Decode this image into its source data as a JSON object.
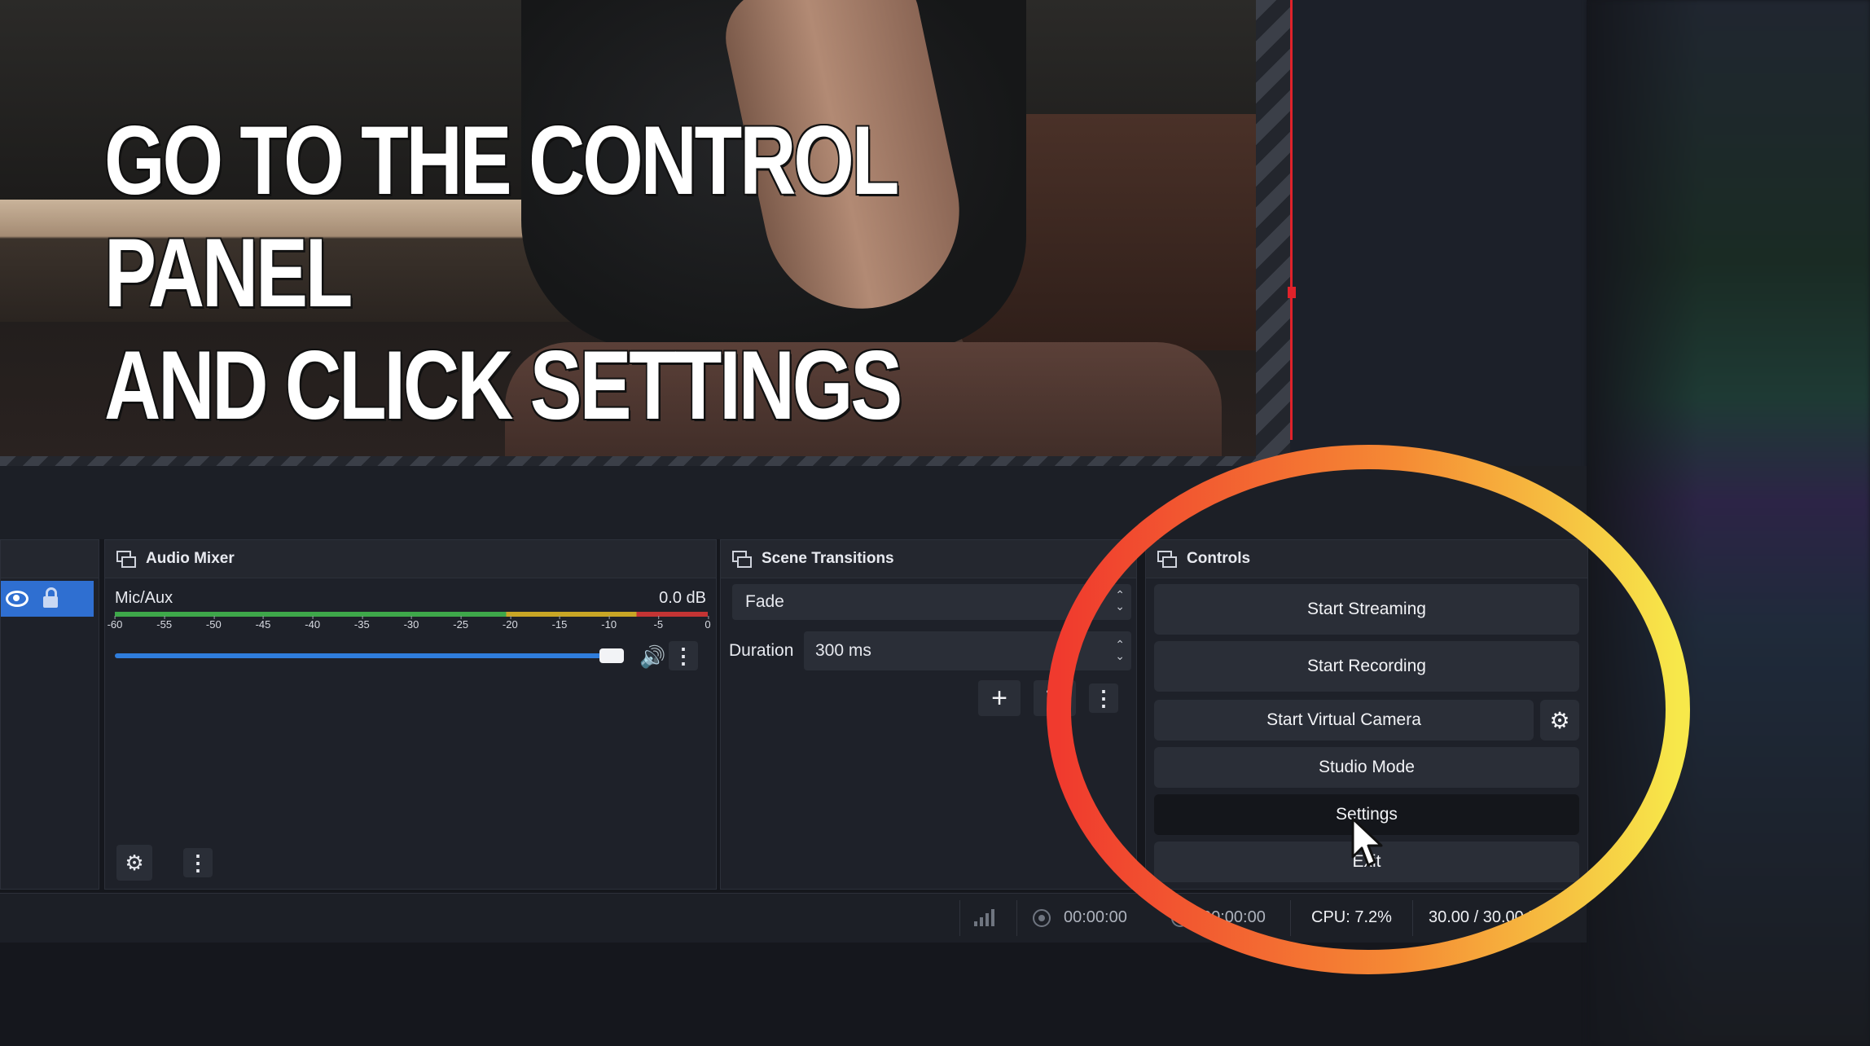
{
  "overlay": {
    "headline_line1": "GO TO THE CONTROL PANEL",
    "headline_line2": "AND CLICK SETTINGS"
  },
  "audio_mixer": {
    "title": "Audio Mixer",
    "source_name": "Mic/Aux",
    "level": "0.0 dB",
    "meter_ticks": [
      "-60",
      "-55",
      "-50",
      "-45",
      "-40",
      "-35",
      "-30",
      "-25",
      "-20",
      "-15",
      "-10",
      "-5",
      "0"
    ],
    "volume_fraction": 0.98
  },
  "scene_transitions": {
    "title": "Scene Transitions",
    "transition": "Fade",
    "duration_label": "Duration",
    "duration_value": "300 ms"
  },
  "controls": {
    "title": "Controls",
    "start_streaming": "Start Streaming",
    "start_recording": "Start Recording",
    "start_virtual_camera": "Start Virtual Camera",
    "studio_mode": "Studio Mode",
    "settings": "Settings",
    "exit": "Exit"
  },
  "status_bar": {
    "stream_time": "00:00:00",
    "record_time": "00:00:00",
    "cpu": "CPU: 7.2%",
    "fps": "30.00 / 30.00 FPS"
  },
  "colors": {
    "accent_blue": "#2f6fd1",
    "ring_start": "#f03a2e",
    "ring_end": "#f7e84a",
    "preview_red_line": "#e0222a"
  }
}
